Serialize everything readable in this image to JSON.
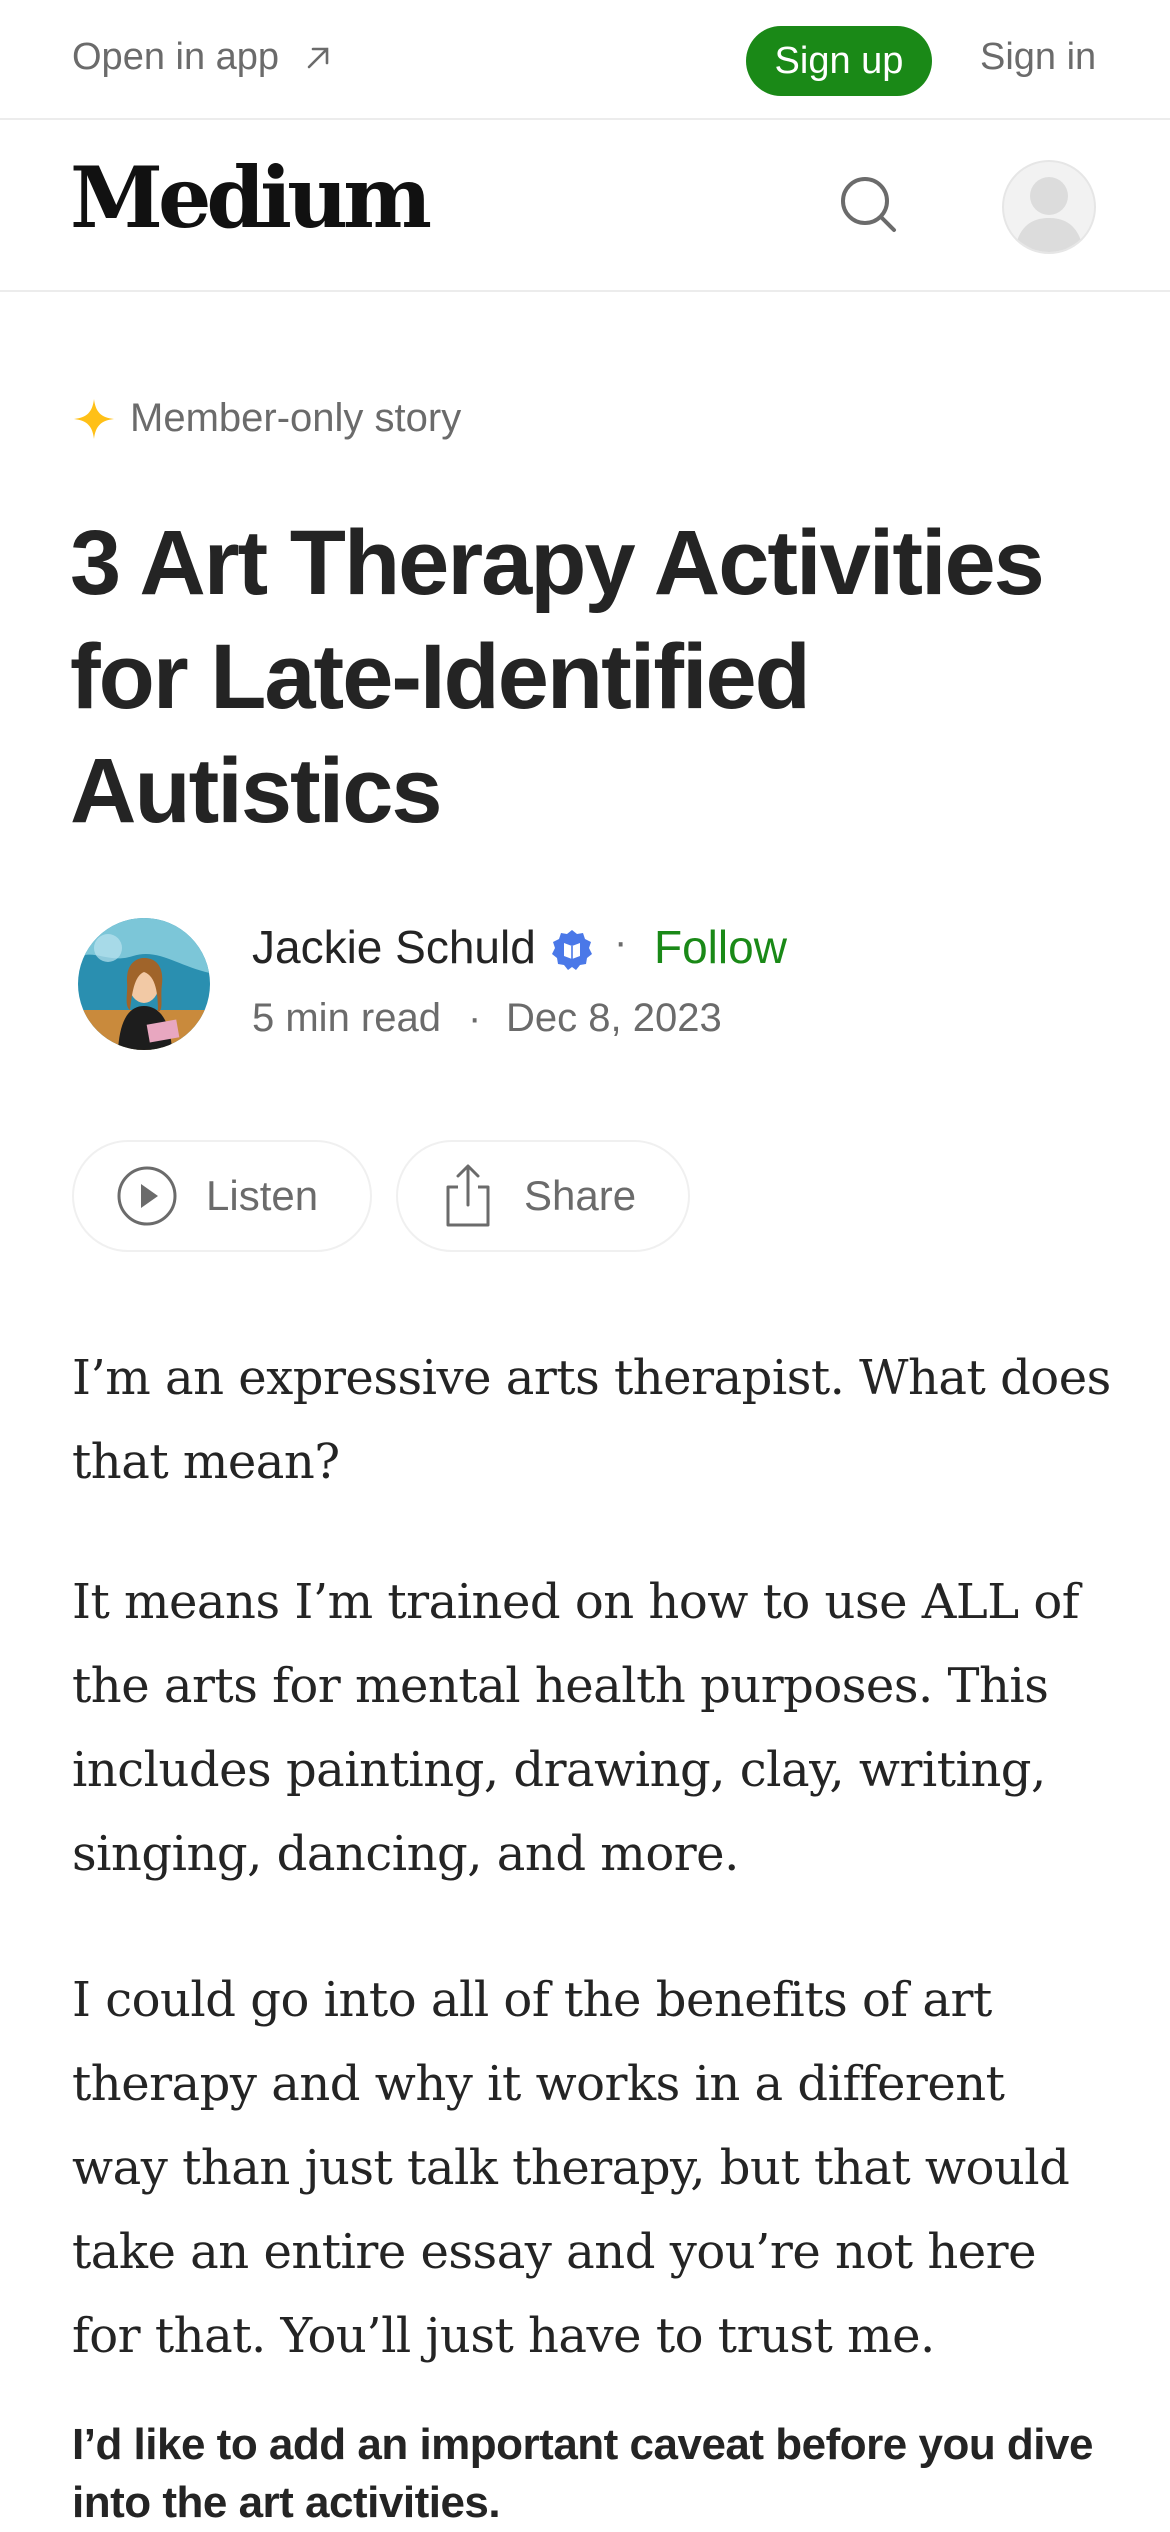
{
  "banner": {
    "open_in_app": "Open in app",
    "sign_up": "Sign up",
    "sign_in": "Sign in"
  },
  "header": {
    "logo": "Medium"
  },
  "article": {
    "member_badge": "Member-only story",
    "title": "3 Art Therapy Activities for Late-Identified Autistics",
    "author": {
      "name": "Jackie Schuld",
      "follow": "Follow",
      "separator": "·",
      "read_time": "5 min read",
      "date": "Dec 8, 2023"
    },
    "actions": {
      "listen": "Listen",
      "share": "Share"
    },
    "paragraphs": [
      "I’m an expressive arts therapist. What does that mean?",
      "It means I’m trained on how to use ALL of the arts for mental health purposes. This includes painting, drawing, clay, writing, singing, dancing, and more.",
      "I could go into all of the benefits of art therapy and why it works in a different way than just talk therapy, but that would take an entire essay and you’re not here for that. You’ll just have to trust me."
    ],
    "caveat": "I’d like to add an important caveat before you dive into the art activities."
  },
  "colors": {
    "brand_green": "#1a8917",
    "member_star": "#ffc017",
    "verified_blue": "#4a78e8",
    "text_primary": "#242424",
    "text_secondary": "#6b6b6b"
  },
  "icons": {
    "open_app": "arrow-up-right-icon",
    "search": "search-icon",
    "user": "user-avatar-icon",
    "member": "star-icon",
    "verified": "verified-badge-icon",
    "listen": "play-circle-icon",
    "share": "share-icon"
  }
}
